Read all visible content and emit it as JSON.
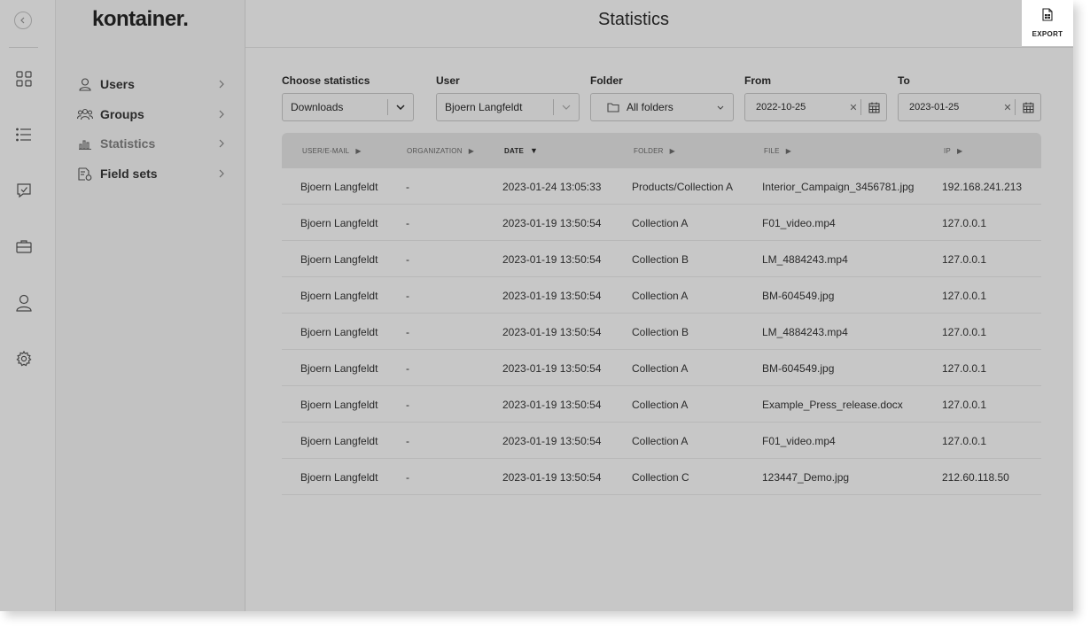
{
  "app": {
    "logo": "kontainer.",
    "page_title": "Statistics",
    "export_label": "EXPORT"
  },
  "rail": {
    "icons": [
      "collapse-icon",
      "grid-icon",
      "list-icon",
      "review-icon",
      "briefcase-icon",
      "user-icon",
      "gear-icon"
    ]
  },
  "sidebar": {
    "items": [
      {
        "label": "Users",
        "icon": "user-icon"
      },
      {
        "label": "Groups",
        "icon": "groups-icon"
      },
      {
        "label": "Statistics",
        "icon": "bar-chart-icon",
        "active": true
      },
      {
        "label": "Field sets",
        "icon": "field-sets-icon"
      }
    ]
  },
  "filters": {
    "statistics": {
      "label": "Choose statistics",
      "value": "Downloads"
    },
    "user": {
      "label": "User",
      "value": "Bjoern Langfeldt"
    },
    "folder": {
      "label": "Folder",
      "value": "All folders"
    },
    "from": {
      "label": "From",
      "value": "2022-10-25"
    },
    "to": {
      "label": "To",
      "value": "2023-01-25"
    }
  },
  "table": {
    "columns": [
      "USER/E-MAIL",
      "ORGANIZATION",
      "DATE",
      "FOLDER",
      "FILE",
      "IP"
    ],
    "sorted_column": "DATE",
    "rows": [
      [
        "Bjoern Langfeldt",
        "-",
        "2023-01-24 13:05:33",
        "Products/Collection A",
        "Interior_Campaign_3456781.jpg",
        "192.168.241.213"
      ],
      [
        "Bjoern Langfeldt",
        "-",
        "2023-01-19 13:50:54",
        "Collection A",
        "F01_video.mp4",
        "127.0.0.1"
      ],
      [
        "Bjoern Langfeldt",
        "-",
        "2023-01-19 13:50:54",
        "Collection B",
        "LM_4884243.mp4",
        "127.0.0.1"
      ],
      [
        "Bjoern Langfeldt",
        "-",
        "2023-01-19 13:50:54",
        "Collection A",
        "BM-604549.jpg",
        "127.0.0.1"
      ],
      [
        "Bjoern Langfeldt",
        "-",
        "2023-01-19 13:50:54",
        "Collection B",
        "LM_4884243.mp4",
        "127.0.0.1"
      ],
      [
        "Bjoern Langfeldt",
        "-",
        "2023-01-19 13:50:54",
        "Collection A",
        "BM-604549.jpg",
        "127.0.0.1"
      ],
      [
        "Bjoern Langfeldt",
        "-",
        "2023-01-19 13:50:54",
        "Collection A",
        "Example_Press_release.docx",
        "127.0.0.1"
      ],
      [
        "Bjoern Langfeldt",
        "-",
        "2023-01-19 13:50:54",
        "Collection A",
        "F01_video.mp4",
        "127.0.0.1"
      ],
      [
        "Bjoern Langfeldt",
        "-",
        "2023-01-19 13:50:54",
        "Collection C",
        "123447_Demo.jpg",
        "212.60.118.50"
      ]
    ]
  },
  "colors": {
    "overlay_grey": "#c7c7c7",
    "sidebar_grey": "#c2c2c2",
    "table_header": "#b6b6b6",
    "export_bg": "#ffffff"
  }
}
